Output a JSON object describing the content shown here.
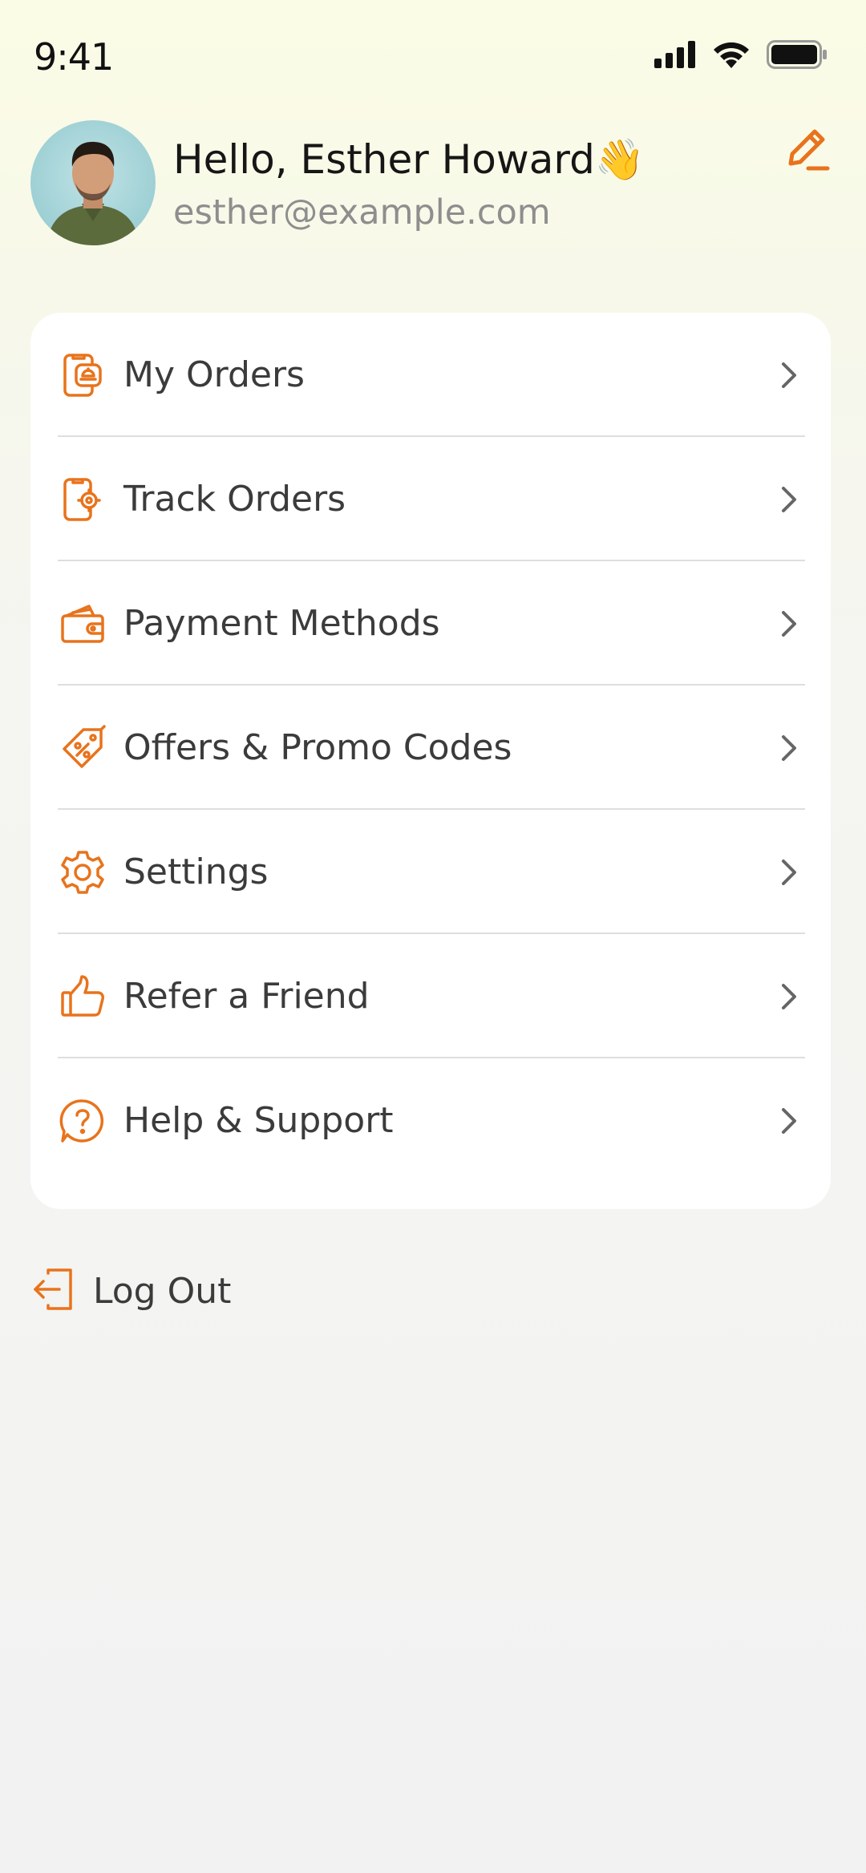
{
  "status_bar": {
    "time": "9:41",
    "icons": [
      "cellular-signal-icon",
      "wifi-icon",
      "battery-icon"
    ]
  },
  "profile": {
    "greeting": "Hello, Esther Howard👋",
    "email": "esther@example.com",
    "edit_icon": "pencil-icon"
  },
  "menu": {
    "items": [
      {
        "label": "My Orders",
        "icon": "phone-bag-icon"
      },
      {
        "label": "Track Orders",
        "icon": "phone-location-icon"
      },
      {
        "label": "Payment Methods",
        "icon": "wallet-icon"
      },
      {
        "label": "Offers & Promo Codes",
        "icon": "discount-tag-icon"
      },
      {
        "label": "Settings",
        "icon": "gear-icon"
      },
      {
        "label": "Refer a Friend",
        "icon": "thumbs-up-icon"
      },
      {
        "label": "Help & Support",
        "icon": "help-question-icon"
      }
    ]
  },
  "logout": {
    "label": "Log Out",
    "icon": "logout-icon"
  },
  "colors": {
    "accent": "#e8731c",
    "text": "#3b3b3b",
    "muted": "#8e8e8e"
  }
}
